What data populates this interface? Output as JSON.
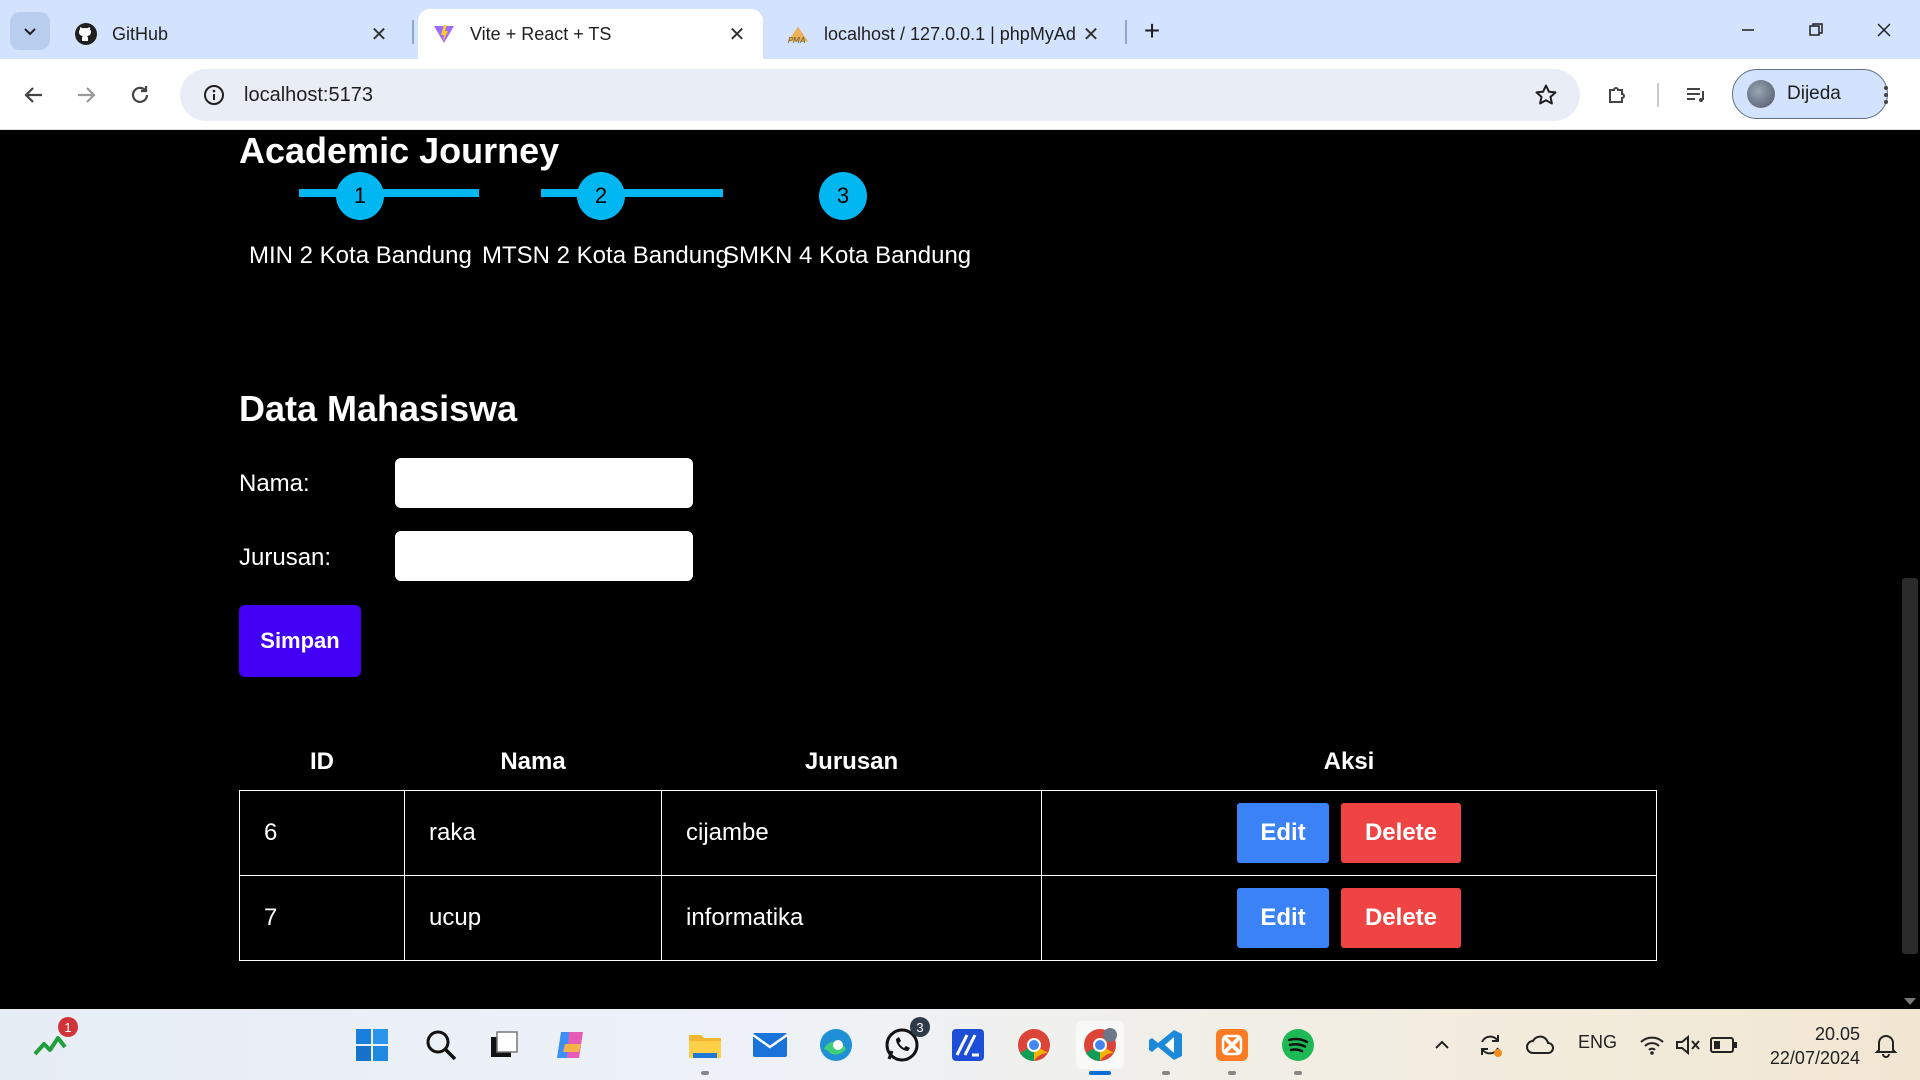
{
  "browser": {
    "tabs": [
      {
        "title": "GitHub",
        "icon": "github-icon"
      },
      {
        "title": "Vite + React + TS",
        "icon": "vite-icon",
        "active": true
      },
      {
        "title": "localhost / 127.0.0.1 | phpMyAd",
        "icon": "phpmyadmin-icon"
      }
    ],
    "url": "localhost:5173",
    "profile_name": "Dijeda"
  },
  "journey": {
    "heading": "Academic Journey",
    "steps": [
      {
        "number": "1",
        "label": "MIN 2 Kota Bandung"
      },
      {
        "number": "2",
        "label": "MTSN 2 Kota Bandung"
      },
      {
        "number": "3",
        "label": "SMKN 4 Kota Bandung"
      }
    ],
    "accent_color": "#00b7f1"
  },
  "form": {
    "heading": "Data Mahasiswa",
    "nama_label": "Nama:",
    "nama_value": "",
    "jurusan_label": "Jurusan:",
    "jurusan_value": "",
    "submit_label": "Simpan",
    "submit_color": "#4200f5"
  },
  "table": {
    "headers": [
      "ID",
      "Nama",
      "Jurusan",
      "Aksi"
    ],
    "rows": [
      {
        "id": "6",
        "nama": "raka",
        "jurusan": "cijambe"
      },
      {
        "id": "7",
        "nama": "ucup",
        "jurusan": "informatika"
      }
    ],
    "edit_label": "Edit",
    "delete_label": "Delete",
    "edit_color": "#3b82f6",
    "delete_color": "#ef4444"
  },
  "taskbar": {
    "widgets_badge": "1",
    "whatsapp_badge": "3",
    "language": "ENG",
    "time": "20.05",
    "date": "22/07/2024"
  }
}
